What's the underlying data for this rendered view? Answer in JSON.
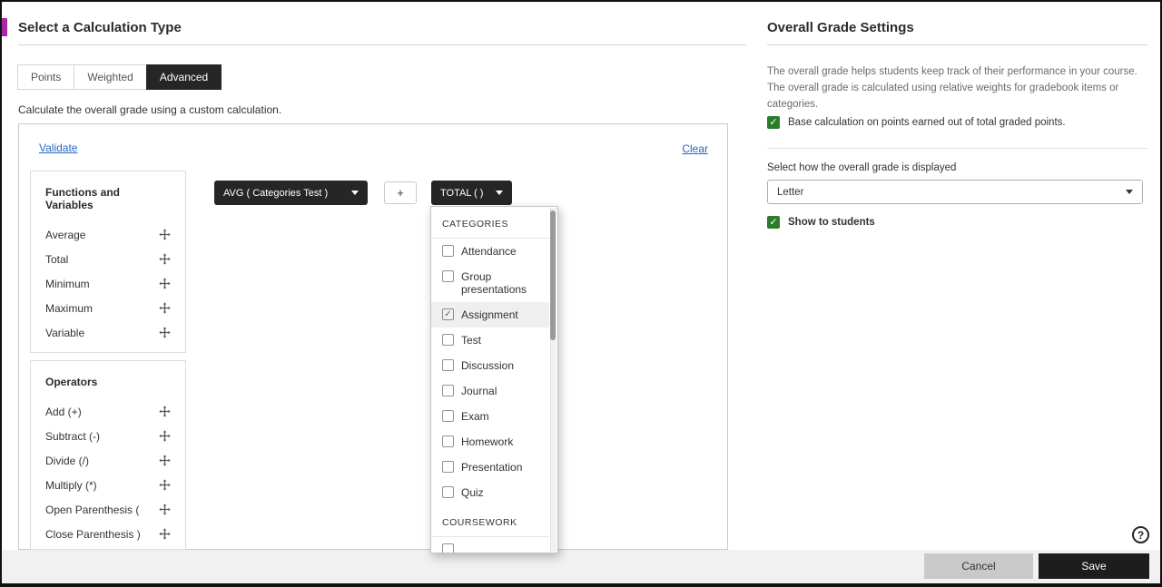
{
  "colors": {
    "accent": "#a72ba8",
    "chip": "#262626",
    "checkbox_green": "#2b7d2b",
    "link_blue": "#2467c5"
  },
  "left_panel": {
    "title": "Select a Calculation Type",
    "tabs": [
      {
        "label": "Points",
        "selected": false
      },
      {
        "label": "Weighted",
        "selected": false
      },
      {
        "label": "Advanced",
        "selected": true
      }
    ],
    "description": "Calculate the overall grade using a custom calculation.",
    "validate_link": "Validate",
    "clear_link": "Clear",
    "functions": {
      "title": "Functions and Variables",
      "items": [
        "Average",
        "Total",
        "Minimum",
        "Maximum",
        "Variable"
      ]
    },
    "operators": {
      "title": "Operators",
      "items": [
        "Add (+)",
        "Subtract (-)",
        "Divide (/)",
        "Multiply (*)",
        "Open Parenthesis (",
        "Close Parenthesis )"
      ]
    },
    "formula": {
      "chips": [
        {
          "label": "AVG ( Categories Test )"
        },
        {
          "label": "+"
        },
        {
          "label": "TOTAL ( )"
        }
      ]
    },
    "dropdown": {
      "sections": [
        {
          "header": "CATEGORIES",
          "items": [
            {
              "label": "Attendance",
              "checked": false,
              "highlighted": false
            },
            {
              "label": "Group presentations",
              "checked": false,
              "highlighted": false
            },
            {
              "label": "Assignment",
              "checked": true,
              "highlighted": true
            },
            {
              "label": "Test",
              "checked": false,
              "highlighted": false
            },
            {
              "label": "Discussion",
              "checked": false,
              "highlighted": false
            },
            {
              "label": "Journal",
              "checked": false,
              "highlighted": false
            },
            {
              "label": "Exam",
              "checked": false,
              "highlighted": false
            },
            {
              "label": "Homework",
              "checked": false,
              "highlighted": false
            },
            {
              "label": "Presentation",
              "checked": false,
              "highlighted": false
            },
            {
              "label": "Quiz",
              "checked": false,
              "highlighted": false
            }
          ]
        },
        {
          "header": "COURSEWORK",
          "items": [
            {
              "label": "",
              "checked": false,
              "highlighted": false
            }
          ]
        }
      ]
    }
  },
  "right_panel": {
    "title": "Overall Grade Settings",
    "description": "The overall grade helps students keep track of their performance in your course. The overall grade is calculated using relative weights for gradebook items or categories.",
    "base_calc_checkbox": {
      "label": "Base calculation on points earned out of total graded points.",
      "checked": true
    },
    "display_label": "Select how the overall grade is displayed",
    "display_select": {
      "value": "Letter"
    },
    "show_to_students_checkbox": {
      "label": "Show to students",
      "checked": true
    }
  },
  "footer": {
    "cancel_label": "Cancel",
    "save_label": "Save"
  },
  "help": {
    "label": "?"
  }
}
